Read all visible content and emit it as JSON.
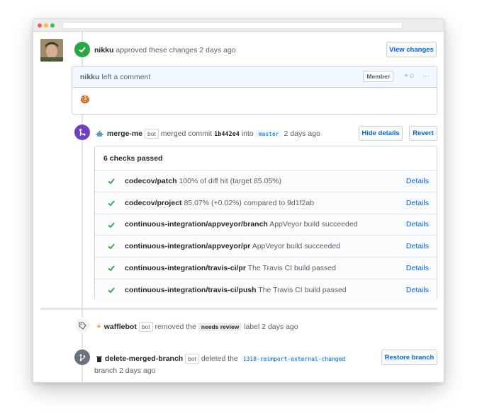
{
  "review": {
    "user": "nikku",
    "action": "approved these changes 2 days ago",
    "view_changes": "View changes"
  },
  "comment": {
    "user": "nikku",
    "action": "left a comment",
    "member": "Member",
    "reaction": "+☺",
    "more": "···",
    "body": "🍪"
  },
  "merge": {
    "user": "merge-me",
    "bot": "bot",
    "action": "merged commit",
    "commit": "1b442e4",
    "into": "into",
    "branch": "master",
    "time": "2 days ago",
    "hide_details": "Hide details",
    "revert": "Revert"
  },
  "checks": {
    "title": "6 checks passed",
    "rows": [
      {
        "context": "codecov/patch",
        "description": "100% of diff hit (target 85.05%)",
        "link": "Details"
      },
      {
        "context": "codecov/project",
        "description": "85.07% (+0.02%) compared to 9d1f2ab",
        "link": "Details"
      },
      {
        "context": "continuous-integration/appveyor/branch",
        "description": "AppVeyor build succeeded",
        "link": "Details"
      },
      {
        "context": "continuous-integration/appveyor/pr",
        "description": "AppVeyor build succeeded",
        "link": "Details"
      },
      {
        "context": "continuous-integration/travis-ci/pr",
        "description": "The Travis CI build passed",
        "link": "Details"
      },
      {
        "context": "continuous-integration/travis-ci/push",
        "description": "The Travis CI build passed",
        "link": "Details"
      }
    ]
  },
  "label_event": {
    "user": "wafflebot",
    "bot": "bot",
    "action": "removed the",
    "label": "needs review",
    "suffix": "label 2 days ago"
  },
  "delete_event": {
    "user": "delete-merged-branch",
    "bot": "bot",
    "action": "deleted the",
    "branch": "1318-reimport-external-changed",
    "suffix": "branch 2 days ago",
    "restore": "Restore branch"
  },
  "colors": {
    "approved": "#28a745",
    "merged": "#6f42c1",
    "link": "#0366d6"
  }
}
